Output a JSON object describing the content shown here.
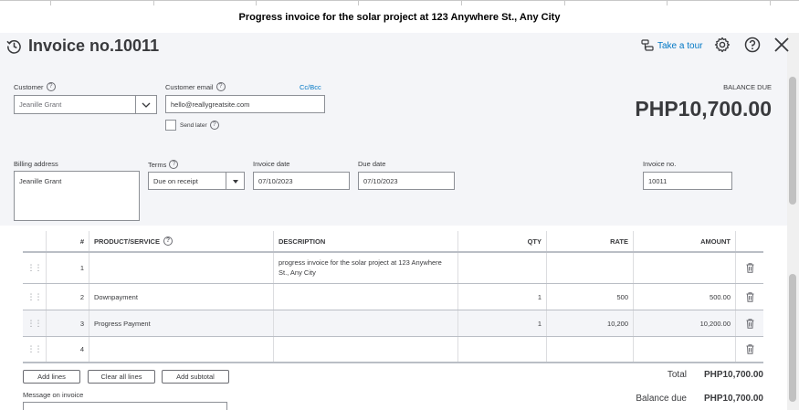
{
  "caption": "Progress invoice for the solar project at 123 Anywhere St., Any City",
  "header": {
    "title": "Invoice no.10011",
    "take_tour": "Take a tour"
  },
  "customer": {
    "label": "Customer",
    "value": "Jeanille Grant"
  },
  "email": {
    "label": "Customer email",
    "value": "hello@reallygreatsite.com",
    "ccbcc": "Cc/Bcc",
    "send_later": "Send later"
  },
  "balance": {
    "label": "BALANCE DUE",
    "amount": "PHP10,700.00"
  },
  "billing": {
    "label": "Billing address",
    "value": "Jeanille Grant"
  },
  "terms": {
    "label": "Terms",
    "value": "Due on receipt"
  },
  "invoice_date": {
    "label": "Invoice date",
    "value": "07/10/2023"
  },
  "due_date": {
    "label": "Due date",
    "value": "07/10/2023"
  },
  "invoice_no": {
    "label": "Invoice no.",
    "value": "10011"
  },
  "table": {
    "headers": {
      "num": "#",
      "product": "PRODUCT/SERVICE",
      "description": "DESCRIPTION",
      "qty": "QTY",
      "rate": "RATE",
      "amount": "AMOUNT"
    },
    "rows": [
      {
        "num": "1",
        "product": "",
        "description": "progress invoice for the solar project at 123 Anywhere St., Any City",
        "qty": "",
        "rate": "",
        "amount": ""
      },
      {
        "num": "2",
        "product": "Downpayment",
        "description": "",
        "qty": "1",
        "rate": "500",
        "amount": "500.00"
      },
      {
        "num": "3",
        "product": "Progress Payment",
        "description": "",
        "qty": "1",
        "rate": "10,200",
        "amount": "10,200.00"
      },
      {
        "num": "4",
        "product": "",
        "description": "",
        "qty": "",
        "rate": "",
        "amount": ""
      }
    ]
  },
  "buttons": {
    "add_lines": "Add lines",
    "clear_all": "Clear all lines",
    "add_subtotal": "Add subtotal"
  },
  "message_label": "Message on invoice",
  "totals": {
    "total_label": "Total",
    "total_value": "PHP10,700.00",
    "balance_label": "Balance due",
    "balance_value": "PHP10,700.00"
  },
  "colors": {
    "accent": "#0077c5",
    "panel_bg": "#f4f5f8",
    "text": "#393a3d"
  }
}
